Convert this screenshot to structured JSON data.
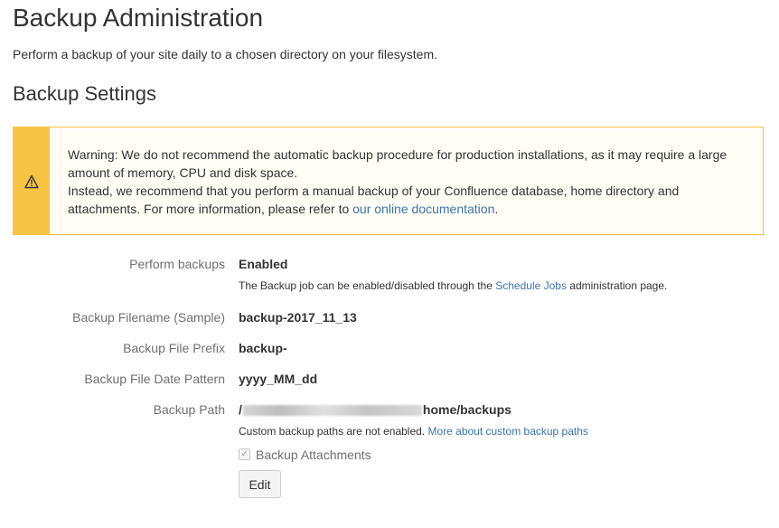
{
  "page": {
    "title": "Backup Administration",
    "intro": "Perform a backup of your site daily to a chosen directory on your filesystem.",
    "section_title": "Backup Settings"
  },
  "warning": {
    "icon": "warning-icon",
    "line1": "Warning: We do not recommend the automatic backup procedure for production installations, as it may require a large amount of memory, CPU and disk space.",
    "line2_prefix": "Instead, we recommend that you perform a manual backup of your Confluence database, home directory and attachments. For more information, please refer to ",
    "line2_link": "our online documentation",
    "line2_suffix": ".",
    "accent_color": "#f6c342"
  },
  "settings": {
    "perform_backups": {
      "label": "Perform backups",
      "value": "Enabled",
      "desc_prefix": "The Backup job can be enabled/disabled through the ",
      "desc_link": "Schedule Jobs",
      "desc_suffix": " administration page."
    },
    "filename_sample": {
      "label": "Backup Filename (Sample)",
      "value": "backup-2017_11_13"
    },
    "file_prefix": {
      "label": "Backup File Prefix",
      "value": "backup-"
    },
    "date_pattern": {
      "label": "Backup File Date Pattern",
      "value": "yyyy_MM_dd"
    },
    "backup_path": {
      "label": "Backup Path",
      "value_prefix": "/",
      "value_suffix": "home/backups",
      "desc_prefix": "Custom backup paths are not enabled. ",
      "desc_link": "More about custom backup paths"
    },
    "attachments": {
      "label": "Backup Attachments",
      "checked": true
    }
  },
  "actions": {
    "edit_label": "Edit"
  },
  "colors": {
    "link": "#3b73af",
    "label": "#707070",
    "text": "#333333"
  }
}
